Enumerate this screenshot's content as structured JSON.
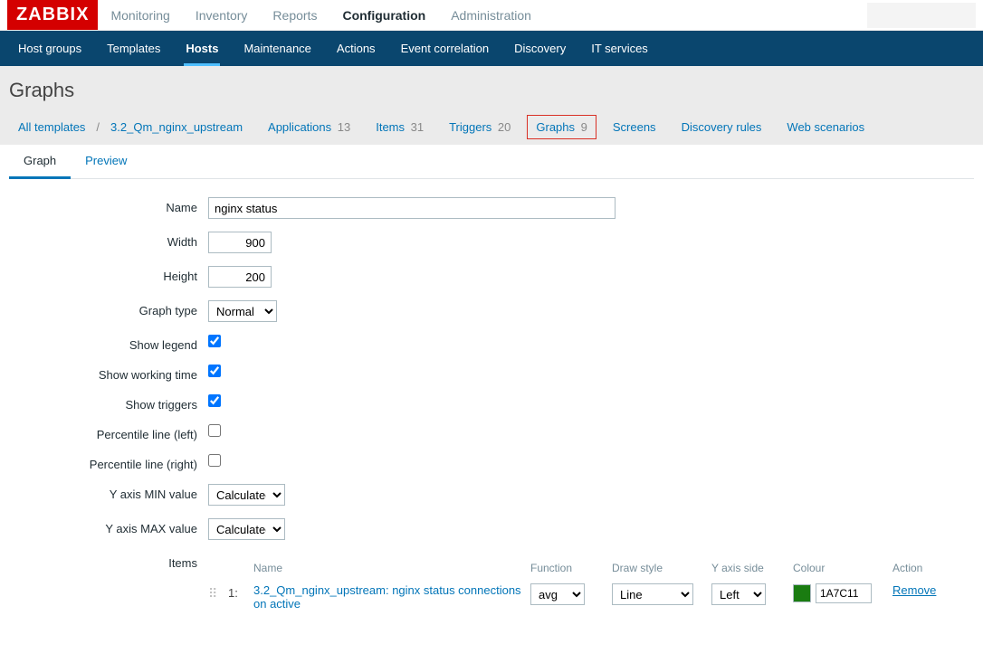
{
  "logo": "ZABBIX",
  "topnav": [
    "Monitoring",
    "Inventory",
    "Reports",
    "Configuration",
    "Administration"
  ],
  "topnav_active": 3,
  "subnav": [
    "Host groups",
    "Templates",
    "Hosts",
    "Maintenance",
    "Actions",
    "Event correlation",
    "Discovery",
    "IT services"
  ],
  "subnav_active": 2,
  "page_title": "Graphs",
  "breadcrumb": {
    "all_templates": "All templates",
    "template": "3.2_Qm_nginx_upstream",
    "items": [
      {
        "label": "Applications",
        "count": "13"
      },
      {
        "label": "Items",
        "count": "31"
      },
      {
        "label": "Triggers",
        "count": "20"
      },
      {
        "label": "Graphs",
        "count": "9",
        "active": true
      },
      {
        "label": "Screens"
      },
      {
        "label": "Discovery rules"
      },
      {
        "label": "Web scenarios"
      }
    ]
  },
  "tabs": [
    "Graph",
    "Preview"
  ],
  "tabs_active": 0,
  "form": {
    "name_label": "Name",
    "name_value": "nginx status",
    "width_label": "Width",
    "width_value": "900",
    "height_label": "Height",
    "height_value": "200",
    "graphtype_label": "Graph type",
    "graphtype_value": "Normal",
    "showlegend_label": "Show legend",
    "showlegend_checked": true,
    "showworking_label": "Show working time",
    "showworking_checked": true,
    "showtriggers_label": "Show triggers",
    "showtriggers_checked": true,
    "pctleft_label": "Percentile line (left)",
    "pctleft_checked": false,
    "pctright_label": "Percentile line (right)",
    "pctright_checked": false,
    "ymin_label": "Y axis MIN value",
    "ymin_value": "Calculated",
    "ymax_label": "Y axis MAX value",
    "ymax_value": "Calculated",
    "items_label": "Items"
  },
  "items_table": {
    "headers": {
      "name": "Name",
      "function": "Function",
      "drawstyle": "Draw style",
      "yaxis": "Y axis side",
      "colour": "Colour",
      "action": "Action"
    },
    "rows": [
      {
        "num": "1:",
        "name": "3.2_Qm_nginx_upstream: nginx status connections on active",
        "function": "avg",
        "drawstyle": "Line",
        "yaxis": "Left",
        "colour": "1A7C11",
        "colour_hex": "#1A7C11",
        "action": "Remove"
      }
    ]
  }
}
